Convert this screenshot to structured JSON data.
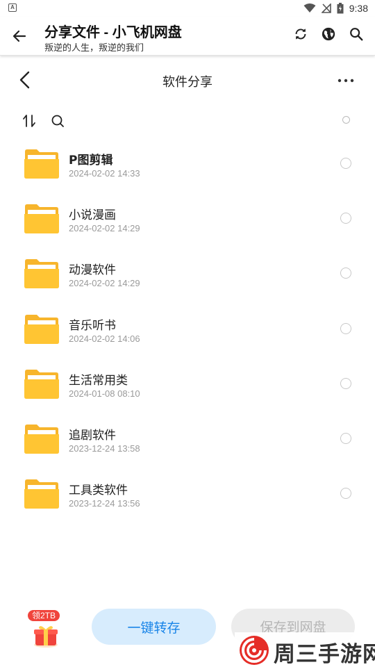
{
  "status_bar": {
    "time": "9:38",
    "left_icon": "a-icon",
    "right_icons": [
      "wifi-icon",
      "no-signal-icon",
      "battery-icon"
    ]
  },
  "app_bar": {
    "title": "分享文件 - 小飞机网盘",
    "subtitle": "叛逆的人生，叛逆的我们",
    "actions": [
      "refresh-icon",
      "globe-icon",
      "search-icon"
    ]
  },
  "page": {
    "title": "软件分享"
  },
  "files": [
    {
      "name": "P图剪辑",
      "date": "2024-02-02 14:33"
    },
    {
      "name": "小说漫画",
      "date": "2024-02-02 14:29"
    },
    {
      "name": "动漫软件",
      "date": "2024-02-02 14:29"
    },
    {
      "name": "音乐听书",
      "date": "2024-02-02 14:06"
    },
    {
      "name": "生活常用类",
      "date": "2024-01-08 08:10"
    },
    {
      "name": "追剧软件",
      "date": "2023-12-24 13:58"
    },
    {
      "name": "工具类软件",
      "date": "2023-12-24 13:56"
    }
  ],
  "bottom": {
    "gift_badge": "领2TB",
    "transfer_label": "一键转存",
    "save_label": "保存到网盘"
  },
  "watermark": {
    "text": "周三手游网"
  },
  "colors": {
    "folder": "#ffc533",
    "accent_blue": "#1a85e8",
    "button_blue_bg": "#d7ecfd",
    "badge_red": "#f0443c"
  }
}
